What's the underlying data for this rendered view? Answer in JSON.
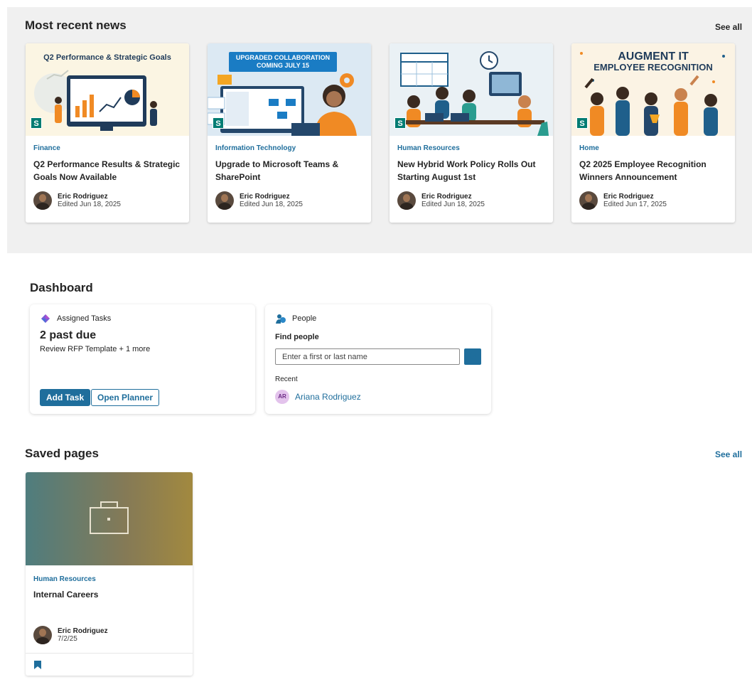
{
  "news": {
    "title": "Most recent news",
    "see_all": "See all",
    "cards": [
      {
        "image_caption": "Q2 Performance & Strategic Goals",
        "category": "Finance",
        "title": "Q2 Performance Results & Strategic Goals Now Available",
        "author": "Eric Rodriguez",
        "date": "Edited Jun 18, 2025"
      },
      {
        "image_caption_1": "UPGRADED COLLABORATION",
        "image_caption_2": "COMING JULY 15",
        "category": "Information Technology",
        "title": "Upgrade to Microsoft Teams & SharePoint",
        "author": "Eric Rodriguez",
        "date": "Edited Jun 18, 2025"
      },
      {
        "category": "Human Resources",
        "title": "New Hybrid Work Policy Rolls Out Starting August 1st",
        "author": "Eric Rodriguez",
        "date": "Edited Jun 18, 2025"
      },
      {
        "image_caption_1": "AUGMENT IT",
        "image_caption_2": "EMPLOYEE RECOGNITION",
        "category": "Home",
        "title": "Q2 2025 Employee Recognition Winners Announcement",
        "author": "Eric Rodriguez",
        "date": "Edited Jun 17, 2025"
      }
    ]
  },
  "dashboard": {
    "title": "Dashboard",
    "tasks": {
      "header": "Assigned Tasks",
      "status": "2 past due",
      "detail": "Review RFP Template + 1 more",
      "add_button": "Add Task",
      "planner_button": "Open Planner"
    },
    "people": {
      "header": "People",
      "find_label": "Find people",
      "search_placeholder": "Enter a first or last name",
      "recent_label": "Recent",
      "recent_initials": "AR",
      "recent_name": "Ariana Rodriguez"
    }
  },
  "saved": {
    "title": "Saved pages",
    "see_all": "See all",
    "card": {
      "category": "Human Resources",
      "title": "Internal Careers",
      "author": "Eric Rodriguez",
      "date": "7/2/25"
    }
  },
  "icons": {
    "sharepoint_badge": "S"
  },
  "colors": {
    "accent": "#1f6e9c",
    "band": "#f0f0f0"
  }
}
